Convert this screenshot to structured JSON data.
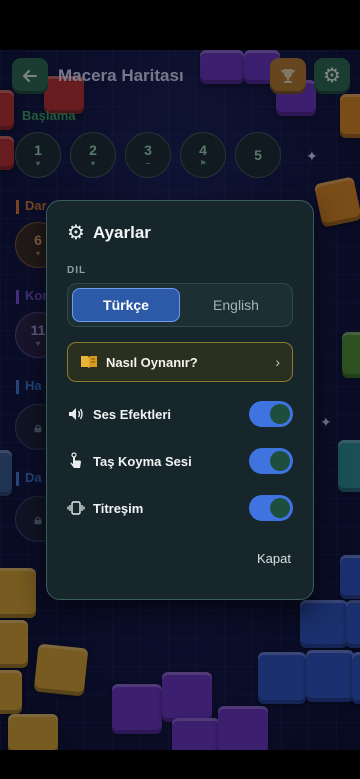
{
  "header": {
    "title": "Macera Haritası"
  },
  "map": {
    "sections": [
      {
        "label": "Başlama",
        "color": "#3aa05a"
      },
      {
        "label": "Dar",
        "color": "#d67a2c"
      },
      {
        "label": "Kon",
        "color": "#7a4fd0"
      },
      {
        "label": "Ha",
        "color": "#3f7ad0"
      },
      {
        "label": "Da",
        "color": "#3f7ad0"
      }
    ],
    "levels": [
      {
        "num": "1",
        "mark": "♥"
      },
      {
        "num": "2",
        "mark": "♥"
      },
      {
        "num": "3",
        "mark": "–"
      },
      {
        "num": "4",
        "mark": "⚑"
      },
      {
        "num": "5",
        "mark": ""
      }
    ],
    "level_6": {
      "num": "6",
      "mark": "♥"
    },
    "level_11": {
      "num": "11",
      "mark": "♥"
    }
  },
  "settings": {
    "title": "Ayarlar",
    "language_label": "DIL",
    "languages": [
      "Türkçe",
      "English"
    ],
    "selected_language": "Türkçe",
    "how_to_play": "Nasıl Oynanır?",
    "toggles": [
      {
        "label": "Ses Efektleri",
        "on": true
      },
      {
        "label": "Taş Koyma Sesi",
        "on": true
      },
      {
        "label": "Titreşim",
        "on": true
      }
    ],
    "close_label": "Kapat"
  },
  "colors": {
    "accent_blue": "#3f73e0",
    "modal_bg": "#16262a",
    "howto_border": "#8a7a2e"
  }
}
